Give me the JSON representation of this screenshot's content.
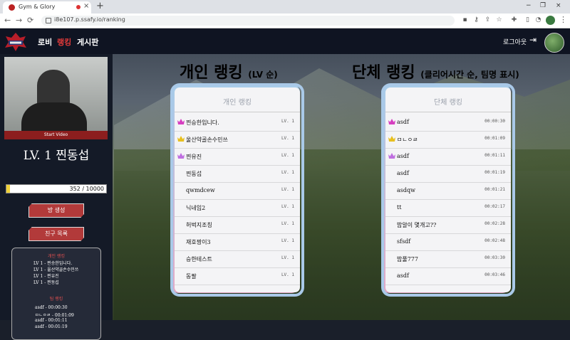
{
  "browser": {
    "tab_title": "Gym & Glory",
    "tab_close": "×",
    "new_tab": "+",
    "url": "i8e107.p.ssafy.io/ranking",
    "window_controls": [
      "−",
      "❐",
      "×"
    ],
    "nav": [
      "←",
      "→",
      "⟳"
    ],
    "extension_icons": [
      "camera-icon",
      "key-icon",
      "share-icon",
      "star-icon",
      "puzzle-icon",
      "sidebar-icon"
    ]
  },
  "header": {
    "nav": [
      "로비",
      "랭킹",
      "게시판"
    ],
    "active_nav": "랭킹",
    "logout": "로그아웃",
    "logout_icon": "⇥"
  },
  "sidebar": {
    "start_video": "Start Video",
    "level_name": "LV. 1 찐동섭",
    "exp_text": "352 / 10000",
    "exp_progress": 0.0352,
    "room_button": "방 생성",
    "friends_button": "친구 목록",
    "mini_rank": {
      "personal_title": "개인 랭킹",
      "personal_lines": [
        "LV 1 - 찐승한입니다.",
        "LV 1 - 울산약골손수민쓰",
        "LV 1 - 찐유진",
        "LV 1 - 찐동섭"
      ],
      "team_title": "팀 랭킹",
      "team_lines": [
        "asdf - 00:00:30",
        "ㅁㄴㅇㄹ - 00:01:09",
        "asdf - 00:01:11",
        "asdf - 00:01:19"
      ]
    }
  },
  "personal": {
    "heading": "개인 랭킹",
    "heading_sub": "(LV 순)",
    "panel_title": "개인 랭킹",
    "rows": [
      {
        "name": "찐승한입니다.",
        "value": "LV. 1",
        "crown": "#d63fc0"
      },
      {
        "name": "울산약골손수민쓰",
        "value": "LV. 1",
        "crown": "#e8c020"
      },
      {
        "name": "찐유진",
        "value": "LV. 1",
        "crown": "#c070e0"
      },
      {
        "name": "찐동섭",
        "value": "LV. 1",
        "crown": ""
      },
      {
        "name": "qwmdcew",
        "value": "LV. 1",
        "crown": ""
      },
      {
        "name": "닉네임2",
        "value": "LV. 1",
        "crown": ""
      },
      {
        "name": "허벅지조칭",
        "value": "LV. 1",
        "crown": ""
      },
      {
        "name": "재호짱이3",
        "value": "LV. 1",
        "crown": ""
      },
      {
        "name": "승한테스트",
        "value": "LV. 1",
        "crown": ""
      },
      {
        "name": "동팔",
        "value": "LV. 1",
        "crown": ""
      }
    ]
  },
  "team": {
    "heading": "단체 랭킹",
    "heading_sub": "(클리어시간 순, 팀명 표시)",
    "panel_title": "단체 랭킹",
    "rows": [
      {
        "name": "asdf",
        "value": "00:00:30",
        "crown": "#d63fc0"
      },
      {
        "name": "ㅁㄴㅇㄹ",
        "value": "00:01:09",
        "crown": "#e8c020"
      },
      {
        "name": "asdf",
        "value": "00:01:11",
        "crown": "#c070e0"
      },
      {
        "name": "asdf",
        "value": "00:01:19",
        "crown": ""
      },
      {
        "name": "asdqw",
        "value": "00:01:21",
        "crown": ""
      },
      {
        "name": "tt",
        "value": "00:02:17",
        "crown": ""
      },
      {
        "name": "밥알이 몇개고??",
        "value": "00:02:28",
        "crown": ""
      },
      {
        "name": "sfsdf",
        "value": "00:02:48",
        "crown": ""
      },
      {
        "name": "밥풀777",
        "value": "00:03:30",
        "crown": ""
      },
      {
        "name": "asdf",
        "value": "00:03:46",
        "crown": ""
      }
    ]
  }
}
